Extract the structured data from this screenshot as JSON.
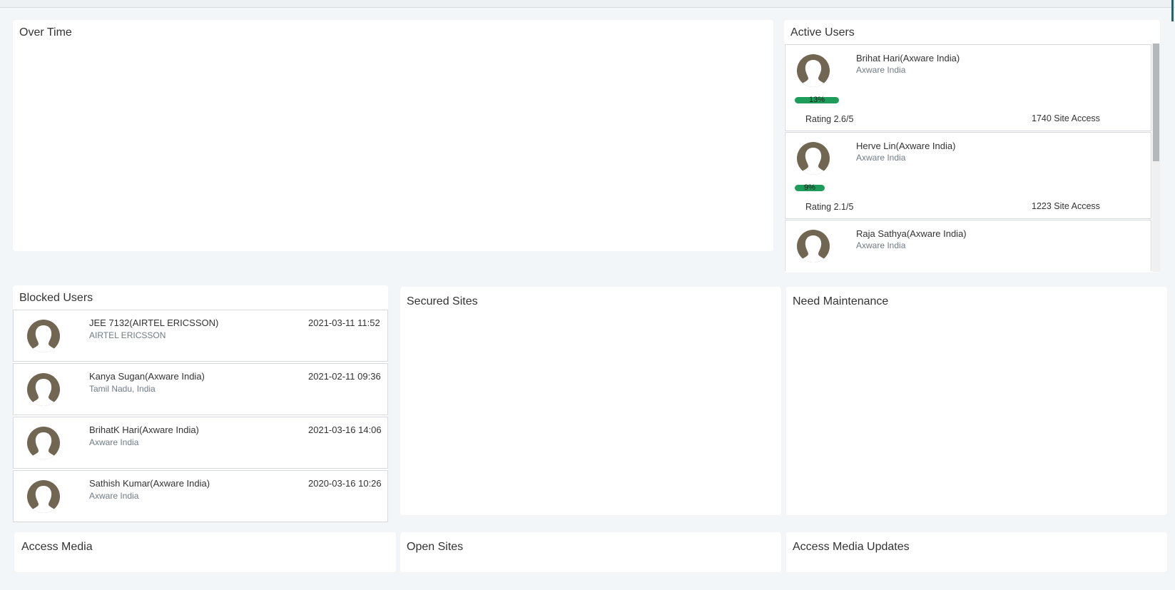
{
  "panels": {
    "over_time": "Over Time",
    "active_users": "Active Users",
    "blocked_users": "Blocked Users",
    "secured_sites": "Secured Sites",
    "need_maintenance": "Need Maintenance",
    "access_media": "Access Media",
    "open_sites": "Open Sites",
    "access_media_updates": "Access Media Updates"
  },
  "active_users": [
    {
      "name": "Brihat Hari(Axware India)",
      "org": "Axware India",
      "percent_label": "13%",
      "percent": 13,
      "rating": "Rating 2.6/5",
      "site_access": "1740 Site Access"
    },
    {
      "name": "Herve Lin(Axware India)",
      "org": "Axware India",
      "percent_label": "9%",
      "percent": 9,
      "rating": "Rating 2.1/5",
      "site_access": "1223 Site Access"
    },
    {
      "name": "Raja Sathya(Axware India)",
      "org": "Axware India"
    }
  ],
  "blocked_users": [
    {
      "name": "JEE 7132(AIRTEL ERICSSON)",
      "org": "AIRTEL ERICSSON",
      "date": "2021-03-11 11:52"
    },
    {
      "name": "Kanya Sugan(Axware India)",
      "org": "Tamil Nadu, India",
      "date": "2021-02-11 09:36"
    },
    {
      "name": "BrihatK Hari(Axware India)",
      "org": "Axware India",
      "date": "2021-03-16 14:06"
    },
    {
      "name": "Sathish Kumar(Axware India)",
      "org": "Axware India",
      "date": "2020-03-16 10:26"
    }
  ],
  "colors": {
    "background": "#f3f6f8",
    "avatar": "#716651",
    "progress": "#1e9c5a",
    "accent": "#2e5f66"
  },
  "icons": {
    "avatar": "user-avatar-icon"
  }
}
